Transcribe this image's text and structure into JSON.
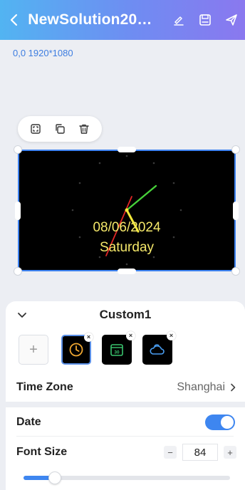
{
  "header": {
    "title": "NewSolution20…",
    "icons": [
      "back-icon",
      "edit-icon",
      "save-icon",
      "send-icon"
    ]
  },
  "canvas": {
    "resolution_label": "0,0 1920*1080",
    "date_text": "08/06/2024",
    "weekday_text": "Saturday",
    "toolbar_icons": [
      "fullscreen-icon",
      "copy-icon",
      "delete-icon"
    ]
  },
  "panel": {
    "title": "Custom1",
    "add_label": "+",
    "styles": [
      {
        "icon": "analog-clock-icon",
        "selected": true
      },
      {
        "icon": "calendar-icon",
        "selected": false
      },
      {
        "icon": "weather-icon",
        "selected": false
      }
    ],
    "remove_label": "×"
  },
  "settings": {
    "timezone_label": "Time Zone",
    "timezone_value": "Shanghai",
    "date_label": "Date",
    "date_enabled": true,
    "font_size_label": "Font Size",
    "font_size_value": "84",
    "decrement_label": "−",
    "increment_label": "+",
    "font_size_slider_fraction": 0.15
  },
  "colors": {
    "accent": "#3e86f0",
    "date_text": "#f5e86a",
    "header_start": "#52b4f2",
    "header_end": "#8a78ef"
  }
}
